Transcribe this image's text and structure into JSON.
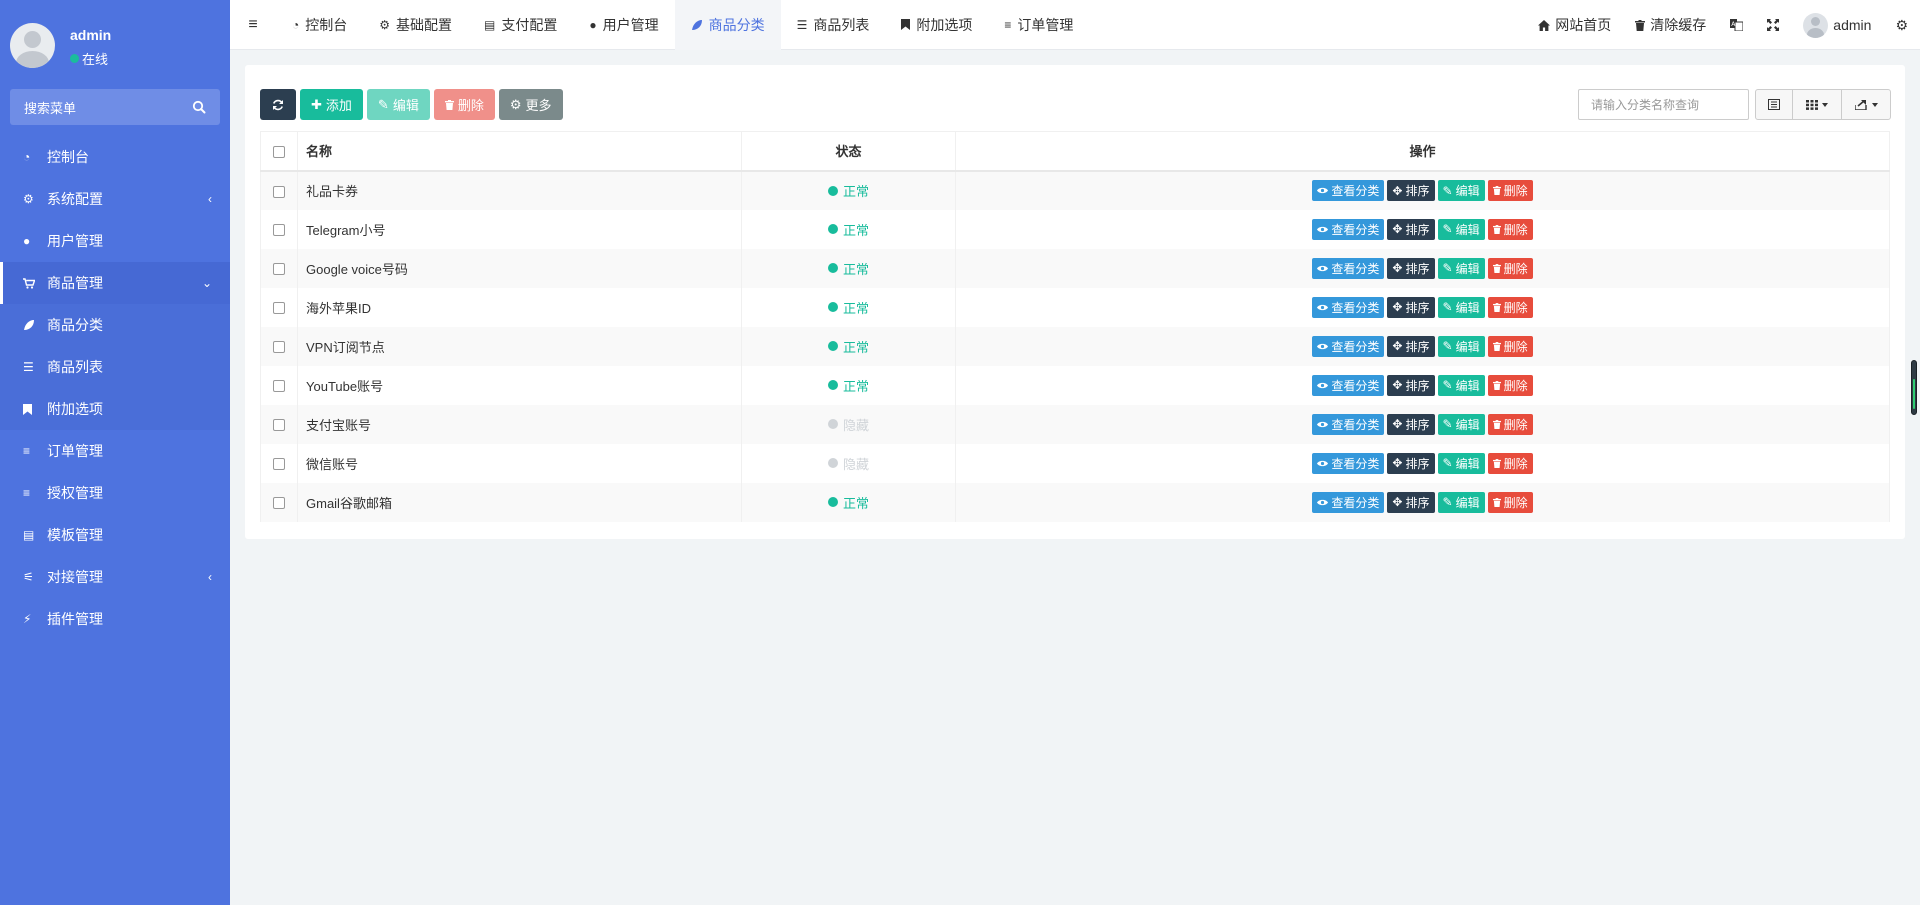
{
  "user": {
    "name": "admin",
    "status": "在线"
  },
  "sidebar": {
    "search_placeholder": "搜索菜单",
    "items": [
      {
        "label": "控制台",
        "icon": "dashboard-icon"
      },
      {
        "label": "系统配置",
        "icon": "gear-icon",
        "chevron": "‹"
      },
      {
        "label": "用户管理",
        "icon": "user-icon"
      },
      {
        "label": "商品管理",
        "icon": "cart-icon",
        "chevron": "⌄"
      },
      {
        "label": "商品分类",
        "icon": "leaf-icon"
      },
      {
        "label": "商品列表",
        "icon": "list-icon"
      },
      {
        "label": "附加选项",
        "icon": "bookmark-icon"
      },
      {
        "label": "订单管理",
        "icon": "bars-icon"
      },
      {
        "label": "授权管理",
        "icon": "bars-icon"
      },
      {
        "label": "模板管理",
        "icon": "window-icon"
      },
      {
        "label": "对接管理",
        "icon": "sliders-icon",
        "chevron": "‹"
      },
      {
        "label": "插件管理",
        "icon": "plug-icon"
      }
    ]
  },
  "navbar": {
    "tabs": [
      {
        "label": "控制台",
        "icon": "dashboard-icon"
      },
      {
        "label": "基础配置",
        "icon": "gear-icon"
      },
      {
        "label": "支付配置",
        "icon": "server-icon"
      },
      {
        "label": "用户管理",
        "icon": "user-icon"
      },
      {
        "label": "商品分类",
        "icon": "leaf-icon"
      },
      {
        "label": "商品列表",
        "icon": "list-icon"
      },
      {
        "label": "附加选项",
        "icon": "bookmark-icon"
      },
      {
        "label": "订单管理",
        "icon": "bars-icon"
      }
    ],
    "right": {
      "home": "网站首页",
      "clear_cache": "清除缓存",
      "user": "admin"
    }
  },
  "toolbar": {
    "add": "添加",
    "edit": "编辑",
    "delete": "删除",
    "more": "更多",
    "search_placeholder": "请输入分类名称查询"
  },
  "table": {
    "headers": {
      "name": "名称",
      "status": "状态",
      "actions": "操作"
    },
    "actions": {
      "view": "查看分类",
      "sort": "排序",
      "edit": "编辑",
      "delete": "删除"
    },
    "rows": [
      {
        "name": "礼品卡券",
        "status": "正常",
        "visible": true
      },
      {
        "name": "Telegram小号",
        "status": "正常",
        "visible": true
      },
      {
        "name": "Google voice号码",
        "status": "正常",
        "visible": true
      },
      {
        "name": "海外苹果ID",
        "status": "正常",
        "visible": true
      },
      {
        "name": "VPN订阅节点",
        "status": "正常",
        "visible": true
      },
      {
        "name": "YouTube账号",
        "status": "正常",
        "visible": true
      },
      {
        "name": "支付宝账号",
        "status": "隐藏",
        "visible": false
      },
      {
        "name": "微信账号",
        "status": "隐藏",
        "visible": false
      },
      {
        "name": "Gmail谷歌邮箱",
        "status": "正常",
        "visible": true
      }
    ]
  },
  "colors": {
    "sidebar_bg": "#4e73df",
    "primary": "#4e73df",
    "success": "#18bc9c",
    "info": "#3498db",
    "dark": "#2c3e50",
    "danger": "#e74c3c"
  }
}
